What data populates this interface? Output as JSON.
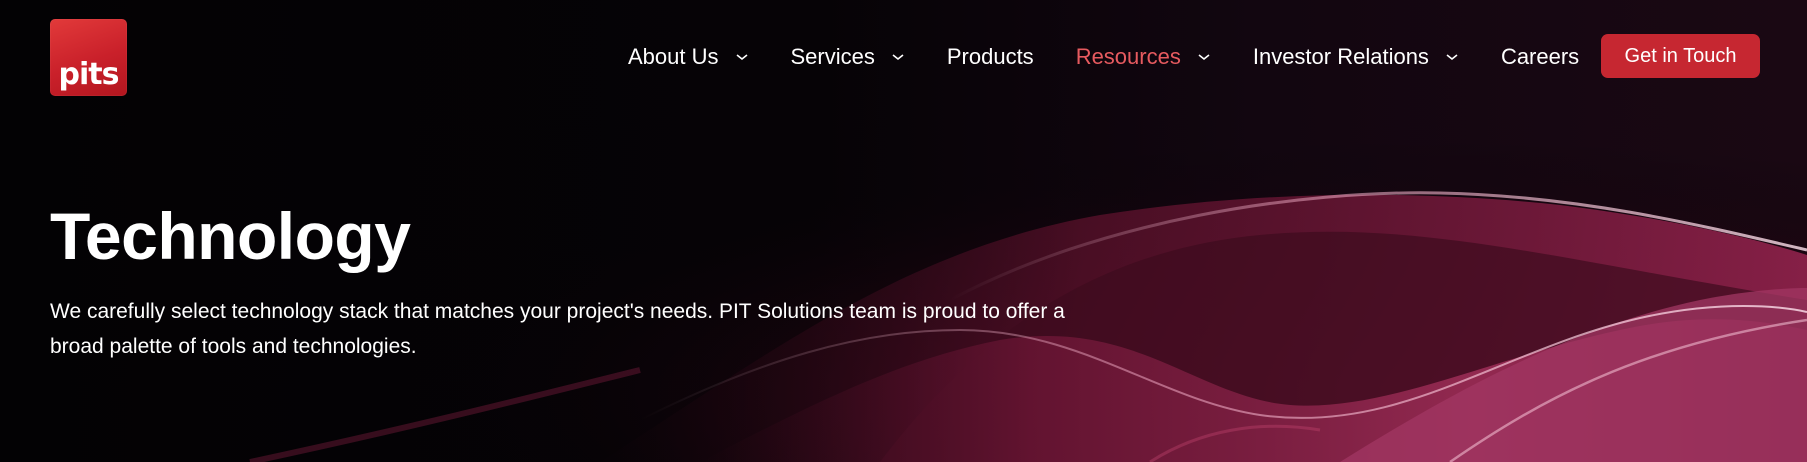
{
  "brand": {
    "logo_text": "pits",
    "accent_color": "#c62731",
    "active_color": "#e65a5f"
  },
  "nav": {
    "items": [
      {
        "label": "About Us",
        "has_dropdown": true,
        "active": false
      },
      {
        "label": "Services",
        "has_dropdown": true,
        "active": false
      },
      {
        "label": "Products",
        "has_dropdown": false,
        "active": false
      },
      {
        "label": "Resources",
        "has_dropdown": true,
        "active": true
      },
      {
        "label": "Investor Relations",
        "has_dropdown": true,
        "active": false
      },
      {
        "label": "Careers",
        "has_dropdown": false,
        "active": false
      }
    ],
    "cta_label": "Get in Touch",
    "dropdown_icon": "chevron-down-icon"
  },
  "hero": {
    "title": "Technology",
    "description_line1": "We carefully select technology stack that matches your project's needs. PIT Solutions team is proud to offer a",
    "description_line2": "broad palette of tools and technologies."
  }
}
